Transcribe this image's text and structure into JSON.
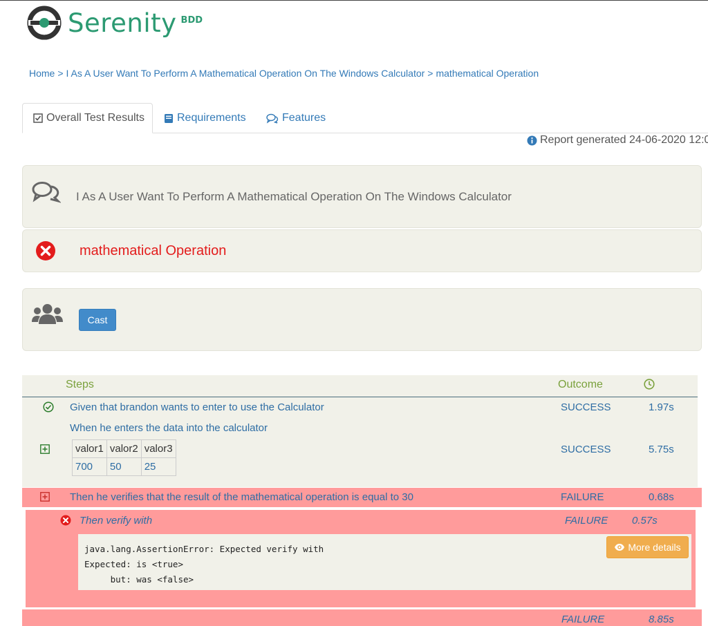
{
  "brand": {
    "name": "Serenity",
    "suffix": "BDD",
    "accent": "#2c9a72"
  },
  "breadcrumb": {
    "items": [
      "Home",
      "I As A User Want To Perform A Mathematical Operation On The Windows Calculator",
      "mathematical Operation"
    ],
    "separator": ">"
  },
  "tabs": [
    {
      "label": "Overall Test Results",
      "icon": "checkbox-icon",
      "active": true
    },
    {
      "label": "Requirements",
      "icon": "book-icon",
      "active": false
    },
    {
      "label": "Features",
      "icon": "comments-icon",
      "active": false
    }
  ],
  "report_generated": "Report generated 24-06-2020 12:0",
  "story": {
    "title": "I As A User Want To Perform A Mathematical Operation On The Windows Calculator",
    "icon": "comments-icon"
  },
  "scenario": {
    "title": "mathematical Operation",
    "status_icon": "error-circle-icon",
    "color": "#e31c1c"
  },
  "cast": {
    "icon": "users-icon",
    "button_label": "Cast"
  },
  "steps_table": {
    "headers": {
      "steps": "Steps",
      "outcome": "Outcome",
      "duration_icon": "clock-icon"
    },
    "rows": [
      {
        "text": "Given that brandon wants to enter to use the Calculator",
        "outcome": "SUCCESS",
        "duration": "1.97s",
        "icon": "check-circle-icon"
      },
      {
        "text": "When he enters the data into the calculator",
        "outcome": "SUCCESS",
        "duration": "5.75s",
        "icon": "plus-square-icon",
        "table": {
          "header": [
            "valor1",
            "valor2",
            "valor3"
          ],
          "values": [
            "700",
            "50",
            "25"
          ]
        }
      },
      {
        "text": "Then he verifies that the result of the mathematical operation is equal to 30",
        "outcome": "FAILURE",
        "duration": "0.68s",
        "icon": "plus-square-icon"
      }
    ],
    "substep": {
      "text": "Then verify with",
      "outcome": "FAILURE",
      "duration": "0.57s",
      "icon": "error-circle-icon",
      "error_lines": [
        "java.lang.AssertionError: Expected verify with",
        "Expected: is <true>",
        "     but: was <false>"
      ],
      "more_details_label": "More details"
    },
    "summary": {
      "outcome": "FAILURE",
      "duration": "8.85s"
    }
  },
  "colors": {
    "failure_bg": "#ff9b9b",
    "panel_bg": "#f1f1e9",
    "link": "#337ab7",
    "header_green": "#7aa13c",
    "button_blue": "#428bca",
    "button_orange": "#f0ad4e"
  }
}
